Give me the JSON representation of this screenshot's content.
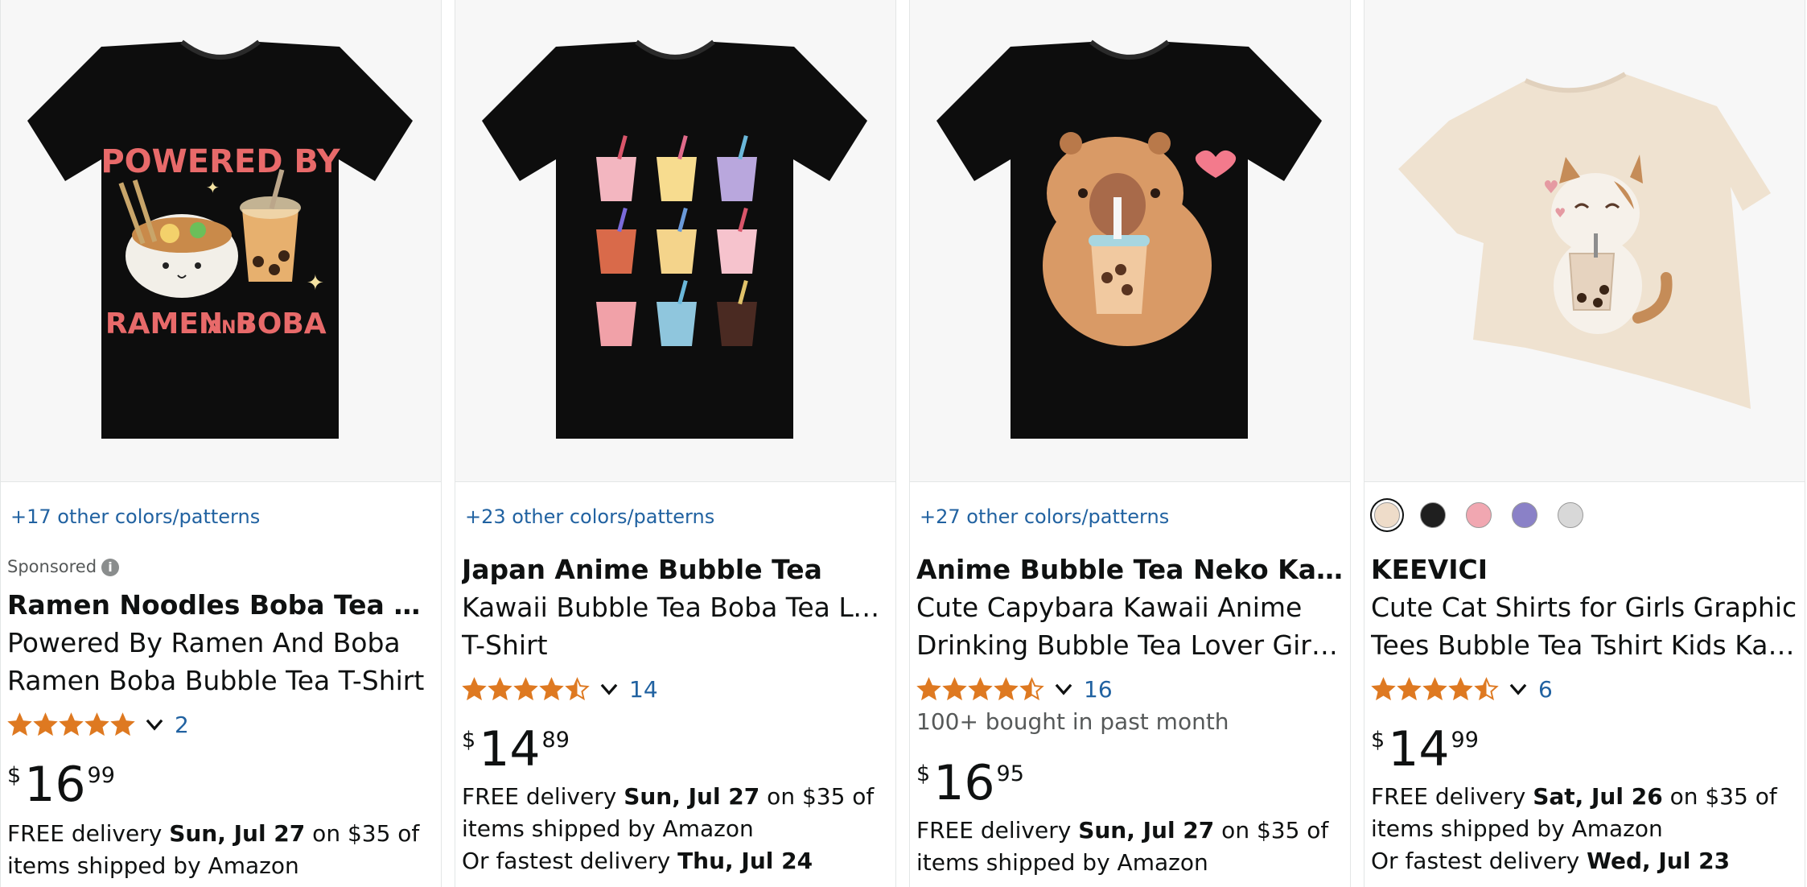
{
  "colors": {
    "link": "#2162a1",
    "star": "#de7921",
    "text": "#0f1111",
    "muted": "#565959"
  },
  "products": [
    {
      "image_icon": "tshirt-ramen-boba",
      "image_text": {
        "line1": "POWERED BY",
        "line2": "RAMEN",
        "line3": "AND",
        "line4": "BOBA"
      },
      "colors_link": "+17 other colors/patterns",
      "sponsored": "Sponsored",
      "brand": "Ramen Noodles Boba Tea Tee Shirt",
      "title_line1": "Powered By Ramen And Boba",
      "title_line2": "Ramen Boba Bubble Tea T-Shirt",
      "rating": 5.0,
      "rating_count": "2",
      "bought": "",
      "price": {
        "symbol": "$",
        "whole": "16",
        "fraction": "99"
      },
      "delivery": {
        "prefix": "FREE delivery ",
        "date": "Sun, Jul 27",
        "suffix": " on $35 of items shipped by Amazon",
        "fast_prefix": "",
        "fast_date": ""
      }
    },
    {
      "image_icon": "tshirt-bubble-tea-cups",
      "colors_link": "+23 other colors/patterns",
      "sponsored": "",
      "brand": "Japan Anime Bubble Tea",
      "title_line1": "Kawaii Bubble Tea Boba Tea Lover",
      "title_line2": "T-Shirt",
      "rating": 4.5,
      "rating_count": "14",
      "bought": "",
      "price": {
        "symbol": "$",
        "whole": "14",
        "fraction": "89"
      },
      "delivery": {
        "prefix": "FREE delivery ",
        "date": "Sun, Jul 27",
        "suffix": " on $35 of items shipped by Amazon",
        "fast_prefix": "Or fastest delivery ",
        "fast_date": "Thu, Jul 24"
      }
    },
    {
      "image_icon": "tshirt-capybara-boba",
      "colors_link": "+27 other colors/patterns",
      "sponsored": "",
      "brand": "Anime Bubble Tea Neko Kawaii…",
      "title_line1": "Cute Capybara Kawaii Anime",
      "title_line2": "Drinking Bubble Tea Lover Girls T-…",
      "rating": 4.5,
      "rating_count": "16",
      "bought": "100+ bought in past month",
      "price": {
        "symbol": "$",
        "whole": "16",
        "fraction": "95"
      },
      "delivery": {
        "prefix": "FREE delivery ",
        "date": "Sun, Jul 27",
        "suffix": " on $35 of items shipped by Amazon",
        "fast_prefix": "",
        "fast_date": ""
      }
    },
    {
      "image_icon": "tshirt-cat-boba",
      "swatches": [
        "#eedcc9",
        "#1f1f1f",
        "#f1a7b1",
        "#8a81c7",
        "#d8d8d8"
      ],
      "colors_link": "",
      "sponsored": "",
      "brand": "KEEVICI",
      "title_line1": "Cute Cat Shirts for Girls Graphic",
      "title_line2": "Tees Bubble Tea Tshirt Kids Kawaii…",
      "rating": 4.5,
      "rating_count": "6",
      "bought": "",
      "price": {
        "symbol": "$",
        "whole": "14",
        "fraction": "99"
      },
      "delivery": {
        "prefix": "FREE delivery ",
        "date": "Sat, Jul 26",
        "suffix": " on $35 of items shipped by Amazon",
        "fast_prefix": "Or fastest delivery ",
        "fast_date": "Wed, Jul 23"
      }
    }
  ]
}
